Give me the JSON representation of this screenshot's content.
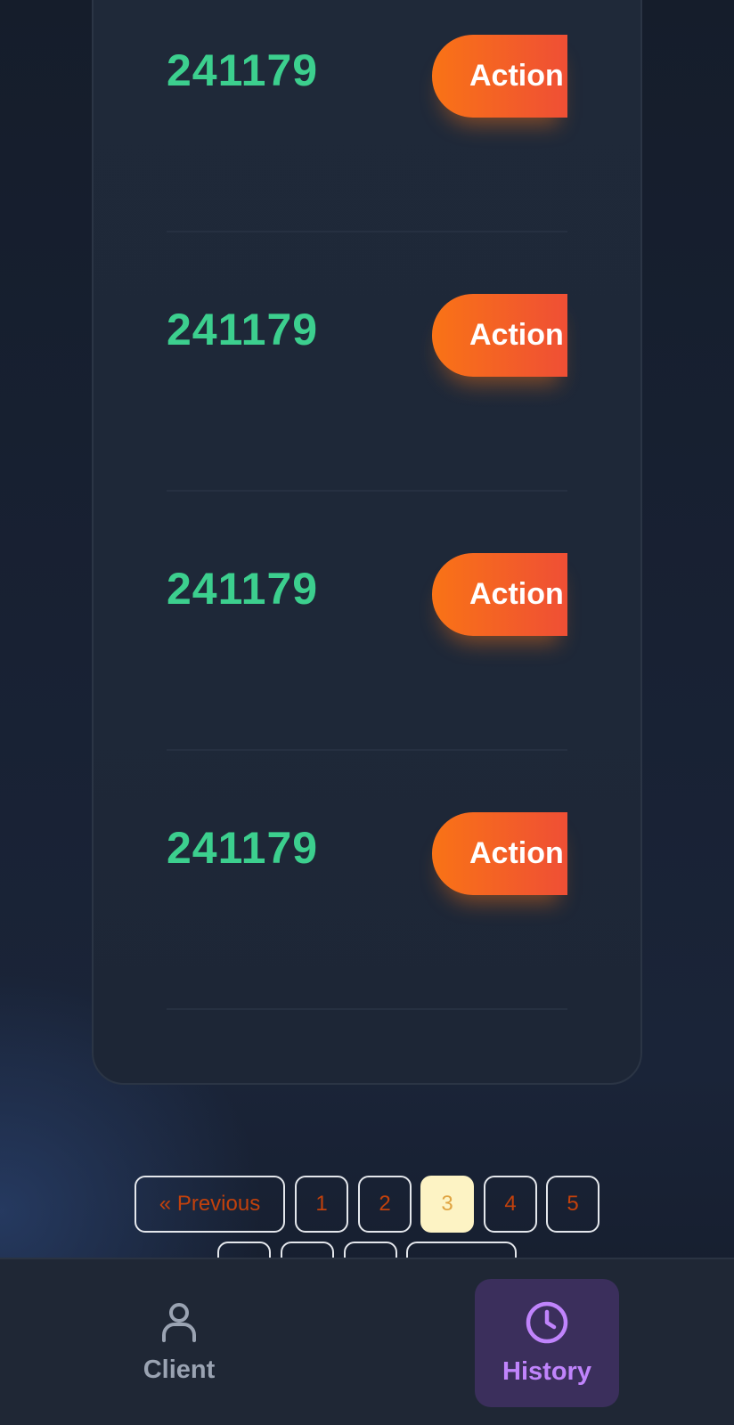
{
  "rows": [
    {
      "value": "241179",
      "action_label": "Action"
    },
    {
      "value": "241179",
      "action_label": "Action"
    },
    {
      "value": "241179",
      "action_label": "Action"
    },
    {
      "value": "241179",
      "action_label": "Action"
    }
  ],
  "pagination": {
    "previous_label": "«  Previous",
    "pages": [
      "1",
      "2",
      "3",
      "4",
      "5"
    ],
    "current_page": "3"
  },
  "bottom_nav": {
    "items": [
      {
        "label": "Client",
        "icon": "user-icon",
        "active": false
      },
      {
        "label": "History",
        "icon": "clock-icon",
        "active": true
      }
    ]
  },
  "colors": {
    "value_green": "#3ccf8e",
    "action_gradient_start": "#f97316",
    "action_gradient_end": "#ef4f35",
    "active_nav": "#c084fc",
    "active_page_bg": "#fdf3c4"
  }
}
